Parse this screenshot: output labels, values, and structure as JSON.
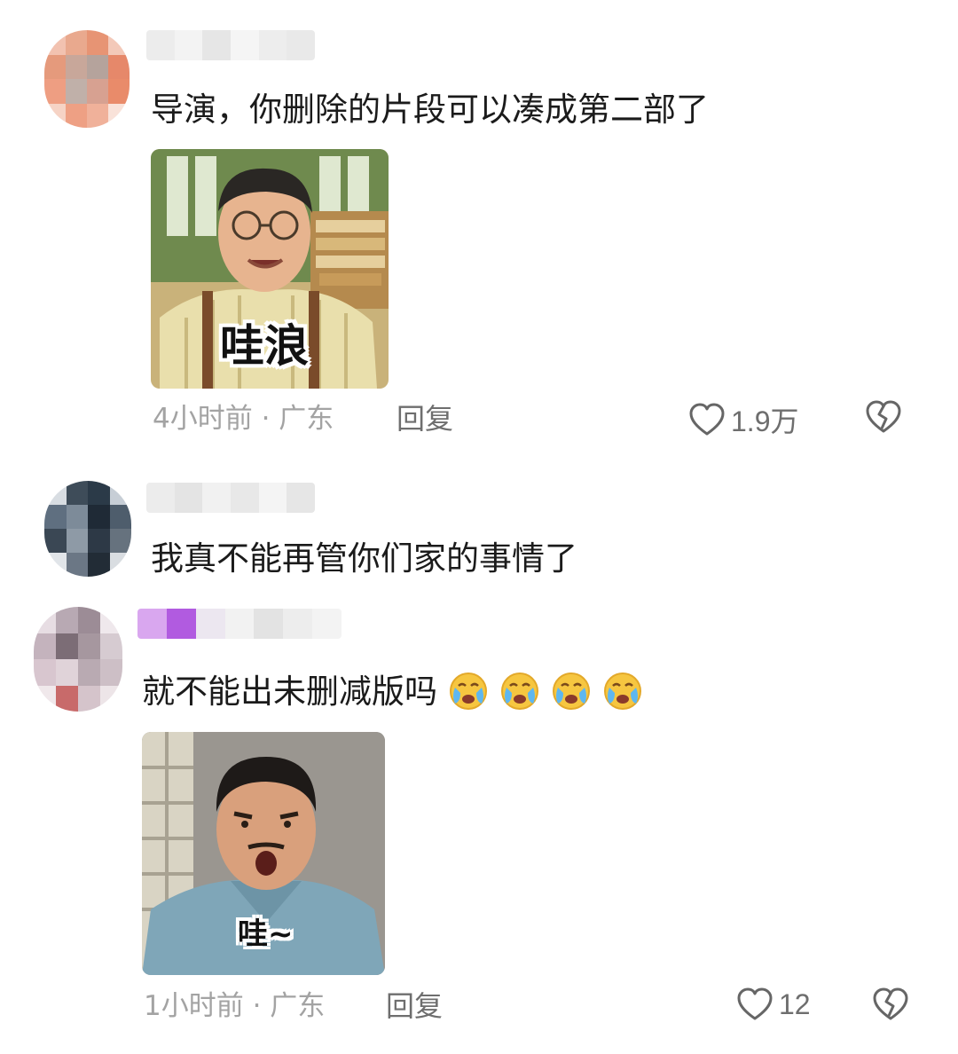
{
  "comments": [
    {
      "text": "导演，你删除的片段可以凑成第二部了",
      "sticker_caption": "哇浪",
      "time_location": "4小时前 · 广东",
      "reply_label": "回复",
      "like_count": "1.9万"
    },
    {
      "text": "我真不能再管你们家的事情了"
    },
    {
      "text": "就不能出未删减版吗",
      "emojis": [
        "crying-face-emoji",
        "crying-face-emoji",
        "crying-face-emoji",
        "crying-face-emoji"
      ],
      "sticker_caption": "哇~",
      "time_location": "1小时前 · 广东",
      "reply_label": "回复",
      "like_count": "12"
    }
  ],
  "colors": {
    "text": "#1b1b1b",
    "meta": "#a3a3a3",
    "action": "#6e6e6e",
    "avatar1": "#e8937a",
    "avatar2": "#4a5a6a",
    "avatar3": "#c9b8c4",
    "username_accent": "#b15be0"
  },
  "icons": {
    "like": "heart-outline-icon",
    "dislike": "broken-heart-icon",
    "emoji": "crying-face-emoji"
  }
}
